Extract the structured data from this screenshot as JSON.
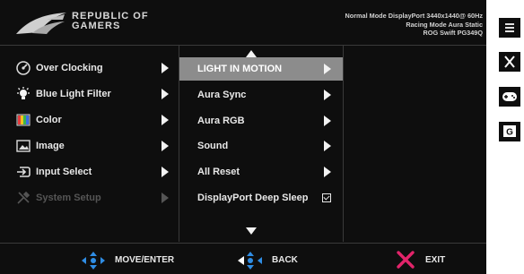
{
  "brand": {
    "line1": "REPUBLIC OF",
    "line2": "GAMERS"
  },
  "status": {
    "line1": "Normal Mode DisplayPort 3440x1440@ 60Hz",
    "line2": "Racing Mode Aura Static",
    "line3": "ROG Swift PG349Q"
  },
  "main_menu": [
    {
      "label": "Over Clocking",
      "icon": "gauge-icon",
      "enabled": true
    },
    {
      "label": "Blue Light Filter",
      "icon": "lightbulb-icon",
      "enabled": true
    },
    {
      "label": "Color",
      "icon": "color-bars-icon",
      "enabled": true
    },
    {
      "label": "Image",
      "icon": "image-icon",
      "enabled": true
    },
    {
      "label": "Input Select",
      "icon": "input-icon",
      "enabled": true
    },
    {
      "label": "System Setup",
      "icon": "wrench-icon",
      "enabled": false
    }
  ],
  "sub_menu": [
    {
      "label": "LIGHT IN MOTION",
      "selected": true,
      "control": "arrow"
    },
    {
      "label": "Aura Sync",
      "control": "arrow"
    },
    {
      "label": "Aura RGB",
      "control": "arrow"
    },
    {
      "label": "Sound",
      "control": "arrow"
    },
    {
      "label": "All Reset",
      "control": "arrow"
    },
    {
      "label": "DisplayPort Deep Sleep",
      "control": "checkbox",
      "checked": true
    }
  ],
  "footer": {
    "move": "MOVE/ENTER",
    "back": "BACK",
    "exit": "EXIT"
  },
  "side_buttons": [
    "menu-icon",
    "close-icon",
    "gamepad-icon",
    "gameplus-icon"
  ],
  "side_labels": {
    "gameplus": "G"
  },
  "colors": {
    "selected_bg": "#8c8c8c",
    "accent_blue": "#2f8de4",
    "exit_pink": "#e2246a",
    "osd_bg": "#0e0e0e"
  }
}
